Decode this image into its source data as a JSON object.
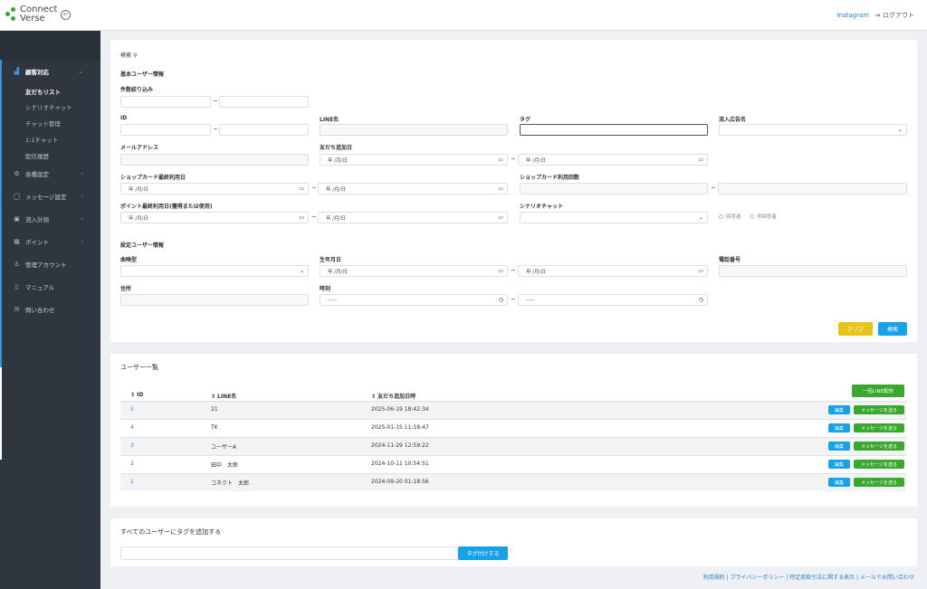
{
  "header": {
    "logo_line1": "Connect",
    "logo_line2": "Verse",
    "collapse_icon": "arrow-left-circle-icon",
    "instagram": "Instagram",
    "logout": "ログアウト"
  },
  "sidebar": {
    "items": [
      {
        "label": "顧客対応",
        "icon": "chart-icon"
      },
      {
        "label": "各種設定",
        "icon": "gear-icon"
      },
      {
        "label": "メッセージ設定",
        "icon": "chat-icon"
      },
      {
        "label": "流入計測",
        "icon": "image-icon"
      },
      {
        "label": "ポイント",
        "icon": "gift-icon"
      },
      {
        "label": "管理アカウント",
        "icon": "user-icon"
      },
      {
        "label": "マニュアル",
        "icon": "book-icon"
      },
      {
        "label": "問い合わせ",
        "icon": "mail-icon"
      }
    ],
    "subitems": [
      "友だちリスト",
      "シナリオチャット",
      "チャット管理",
      "1:1チャット",
      "配信履歴"
    ]
  },
  "search": {
    "title": "検索",
    "basic_section": "基本ユーザー情報",
    "count_filter": "件数絞り込み",
    "id": "ID",
    "line_name": "LINE名",
    "tag": "タグ",
    "ad_name": "流入広告名",
    "email": "メールアドレス",
    "friend_date": "友だち追加日",
    "shop_last": "ショップカード最終利用日",
    "shop_count": "ショップカード利用回数",
    "point_last": "ポイント最終利用日(獲得または使用)",
    "scenario": "シナリオチャット",
    "answered": "回答者",
    "unanswered": "非回答者",
    "setting_section": "設定ユーザー情報",
    "song": "曲喚型",
    "birthday": "生年月日",
    "phone": "電話番号",
    "address": "住所",
    "time": "時刻",
    "date_placeholder": "年 /月/日",
    "time_placeholder": "--:--",
    "clear_btn": "クリア",
    "search_btn": "検索"
  },
  "users": {
    "title": "ユーザー一覧",
    "col_id": "⇕ ID",
    "col_name": "⇕ LINE名",
    "col_date": "⇕ 友だち追加日時",
    "bulk_btn": "一括LINE配信",
    "edit_btn": "編集",
    "send_btn": "メッセージを送る",
    "rows": [
      {
        "id": "5",
        "name": "21",
        "date": "2025-06-19 18:42:34"
      },
      {
        "id": "4",
        "name": "TK",
        "date": "2025-01-15 11:18:47"
      },
      {
        "id": "3",
        "name": "ユーザーA",
        "date": "2024-11-29 12:59:22"
      },
      {
        "id": "2",
        "name": "田中　太郎",
        "date": "2024-10-11 10:54:51"
      },
      {
        "id": "1",
        "name": "コネクト　太郎",
        "date": "2024-09-20 01:18:56"
      }
    ]
  },
  "tagall": {
    "title": "すべてのユーザーにタグを追加する",
    "btn": "タグ付けする"
  },
  "footer": "利用規約 | プライバシーポリシー | 特定商取引法に関する表示 | メールでお問い合わせ",
  "colors": {
    "accent": "#17a2e8",
    "green": "#3aa82e",
    "yellow": "#e8c31a",
    "sidebar": "#2f3640"
  }
}
